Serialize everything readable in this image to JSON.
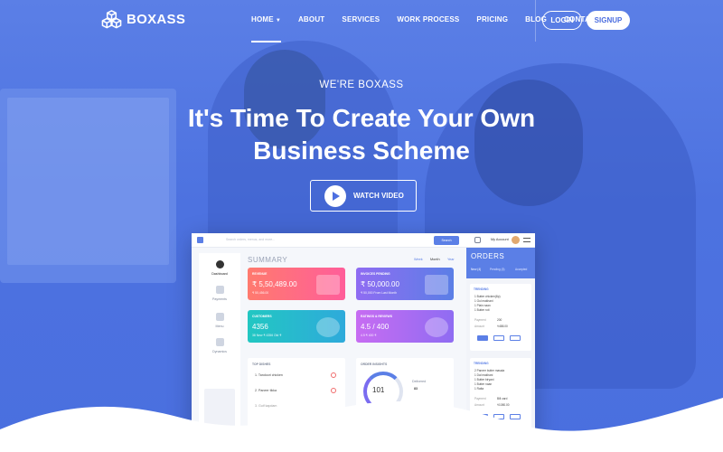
{
  "brand": {
    "name": "BOXASS"
  },
  "nav": {
    "items": [
      {
        "label": "HOME",
        "active": true,
        "has_dropdown": true
      },
      {
        "label": "ABOUT"
      },
      {
        "label": "SERVICES"
      },
      {
        "label": "WORK PROCESS"
      },
      {
        "label": "PRICING"
      },
      {
        "label": "BLOG"
      },
      {
        "label": "CONTACT"
      }
    ],
    "login_label": "LOGIN",
    "signup_label": "SIGNUP"
  },
  "hero": {
    "eyebrow": "WE'RE BOXASS",
    "headline_line1": "It's Time To Create Your Own",
    "headline_line2": "Business Scheme",
    "cta_label": "WATCH VIDEO",
    "cta_icon": "play-icon"
  },
  "dashboard": {
    "search_placeholder": "Search orders, menus, and more...",
    "search_button": "Search",
    "account_label": "My Account",
    "sidebar": [
      {
        "label": "Dashboard",
        "active": true
      },
      {
        "label": "Payments"
      },
      {
        "label": "Menu"
      },
      {
        "label": "Dynamics"
      }
    ],
    "summary_title": "SUMMARY",
    "periods": [
      "Week",
      "Month",
      "Year"
    ],
    "cards": [
      {
        "label": "REVENUE",
        "value": "₹ 5,50,489.00",
        "sub": "₹ 50,456.00",
        "color_from": "#ff7a6e",
        "color_to": "#ff5e9a"
      },
      {
        "label": "INVOICES PENDING",
        "value": "₹ 50,000.00",
        "sub": "₹ 50,000 From Last Month",
        "color_from": "#8f6cf2",
        "color_to": "#5b7fe6"
      },
      {
        "label": "CUSTOMERS",
        "value": "4356",
        "sub": "38 New ₹   4356 Old ₹",
        "color_from": "#22c7c2",
        "color_to": "#2eaadb"
      },
      {
        "label": "RATINGS & REVIEWS",
        "value": "4.5 / 400",
        "sub": "4.5 ₹       400 ₹",
        "color_from": "#c76cf2",
        "color_to": "#8f6cf2"
      }
    ],
    "top_dishes": {
      "title": "TOP DISHES",
      "items": [
        "1. Tandoori chicken",
        "2. Paneer tikka",
        "3. Gulf kapdam"
      ]
    },
    "order_insights": {
      "title": "ORDER INSIGHTS",
      "gauge_value": "101",
      "delivered_label": "Delivered",
      "delivered_value": "83",
      "percent_label": "3%"
    },
    "orders": {
      "title": "ORDERS",
      "tabs": [
        "New (4)",
        "Pending (3)",
        "Accepted"
      ],
      "cards": [
        {
          "status": "TRENDING",
          "items": [
            "1 Butter chicken(8p)",
            "1 Gul makhani",
            "1 Plain naan",
            "1 Butter roti"
          ],
          "payment_label": "Payment",
          "payment_value": "200",
          "amount_label": "Amount",
          "amount_value": "₹488.00"
        },
        {
          "status": "TRENDING",
          "items": [
            "2 Paneer butter masala",
            "1 Dal makhani",
            "1 Butter biryani",
            "1 Butter naan",
            "1 Raita"
          ],
          "payment_label": "Payment",
          "payment_value": "Bill card",
          "amount_label": "Amount",
          "amount_value": "₹1080.00"
        }
      ]
    }
  },
  "colors": {
    "hero_blue": "#4d72e0",
    "accent": "#5b7fe6",
    "white": "#ffffff"
  }
}
